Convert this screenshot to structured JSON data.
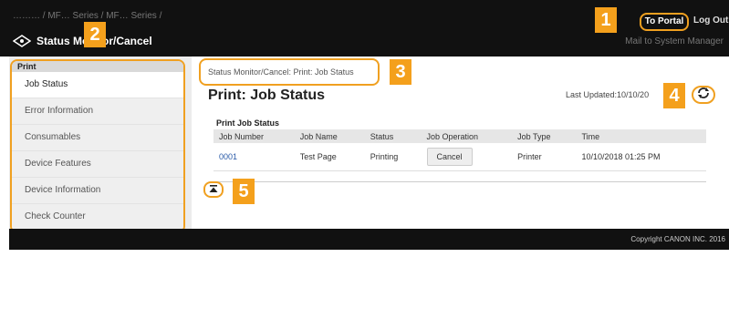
{
  "header": {
    "breadcrumb_top": "……… / MF… Series / MF… Series /",
    "app_title": "Status Monitor/Cancel",
    "to_portal": "To Portal",
    "log_out": "Log Out",
    "mail_to": "Mail to System Manager"
  },
  "sidebar": {
    "heading": "Print",
    "items": [
      {
        "label": "Job Status"
      },
      {
        "label": "Error Information"
      },
      {
        "label": "Consumables"
      },
      {
        "label": "Device Features"
      },
      {
        "label": "Device Information"
      },
      {
        "label": "Check Counter"
      }
    ]
  },
  "main": {
    "breadcrumb": "Status Monitor/Cancel: Print: Job Status",
    "page_title": "Print: Job Status",
    "last_updated": "Last Updated:10/10/20",
    "section_title": "Print Job Status",
    "columns": [
      "Job Number",
      "Job Name",
      "Status",
      "Job Operation",
      "Job Type",
      "Time"
    ],
    "rows": [
      {
        "job_number": "0001",
        "job_name": "Test Page",
        "status": "Printing",
        "operation": "Cancel",
        "job_type": "Printer",
        "time": "10/10/2018 01:25 PM"
      }
    ]
  },
  "footer": {
    "copyright": "Copyright CANON INC. 2016"
  },
  "callouts": [
    "1",
    "2",
    "3",
    "4",
    "5"
  ],
  "colors": {
    "accent": "#f4a01c",
    "header_bg": "#111111",
    "link": "#2a5aa8"
  }
}
